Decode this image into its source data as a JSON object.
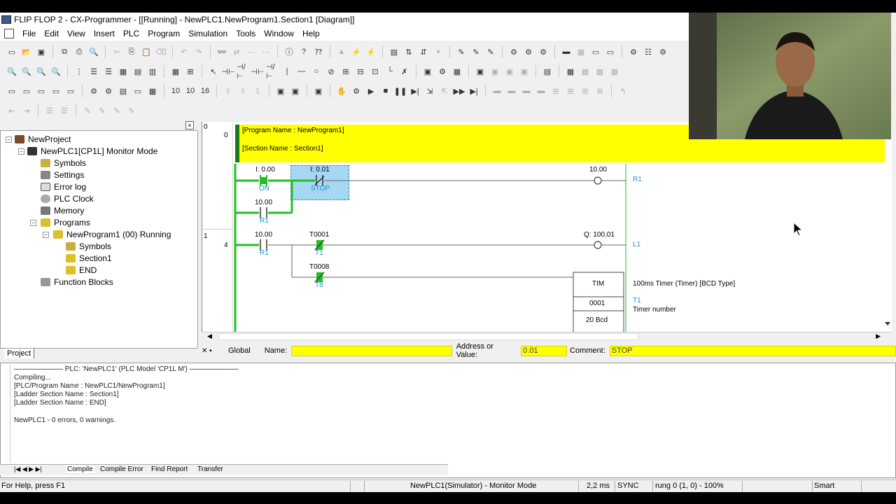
{
  "window": {
    "title": "FLIP FLOP 2 - CX-Programmer - [[Running] - NewPLC1.NewProgram1.Section1 [Diagram]]"
  },
  "menu": [
    "File",
    "Edit",
    "View",
    "Insert",
    "PLC",
    "Program",
    "Simulation",
    "Tools",
    "Window",
    "Help"
  ],
  "tree": {
    "project": "NewProject",
    "plc": "NewPLC1[CP1L] Monitor Mode",
    "symbols": "Symbols",
    "settings": "Settings",
    "errorlog": "Error log",
    "plcclock": "PLC Clock",
    "memory": "Memory",
    "programs": "Programs",
    "program1": "NewProgram1 (00) Running",
    "psymbols": "Symbols",
    "section1": "Section1",
    "end": "END",
    "fblocks": "Function Blocks",
    "tab": "Project"
  },
  "diagram": {
    "rung0_num": "0",
    "rung0_step": "0",
    "rung1_num": "1",
    "rung1_step": "4",
    "program_name": "[Program Name : NewProgram1]",
    "section_name": "[Section Name : Section1]",
    "c1_addr": "I: 0.00",
    "c1_name": "ON",
    "c2_addr": "I: 0.01",
    "c2_name": "STOP",
    "c3_addr": "10.00",
    "c3_name": "R1",
    "coil1_addr": "10.00",
    "coil1_name": "R1",
    "c4_addr": "10.00",
    "c4_name": "R1",
    "c5_addr": "T0001",
    "c5_name": "T1",
    "c6_addr": "T0008",
    "c6_name": "T8",
    "coil2_addr": "Q: 100.01",
    "coil2_name": "L1",
    "tim_label": "TIM",
    "tim_num": "0001",
    "tim_set": "20 Bcd",
    "tim_desc": "100ms Timer (Timer) [BCD Type]",
    "tim_t1": "T1",
    "tim_tn": "Timer number"
  },
  "watch": {
    "scope": "Global",
    "name_label": "Name:",
    "name_value": "",
    "addr_label": "Address or Value:",
    "addr_value": "0.01",
    "comment_label": "Comment:",
    "comment_value": "STOP"
  },
  "output": {
    "header": "PLC: 'NewPLC1' (PLC Model 'CP1L M')",
    "lines": [
      "Compiling...",
      "[PLC/Program Name : NewPLC1/NewProgram1]",
      "[Ladder Section Name : Section1]",
      "[Ladder Section Name : END]",
      "",
      "NewPLC1 - 0 errors, 0 warnings."
    ],
    "tabs": [
      "Compile",
      "Compile Error",
      "Find Report",
      "Transfer"
    ]
  },
  "status": {
    "help": "For Help, press F1",
    "mode": "NewPLC1(Simulator) - Monitor Mode",
    "time": "2,2 ms",
    "sync": "SYNC",
    "rung": "rung 0 (1, 0)  - 100%",
    "smart": "Smart"
  },
  "colors": {
    "power": "#22c022",
    "yellow": "#ffff00",
    "cyan": "#1e90c8",
    "select": "#a6d8f4"
  }
}
